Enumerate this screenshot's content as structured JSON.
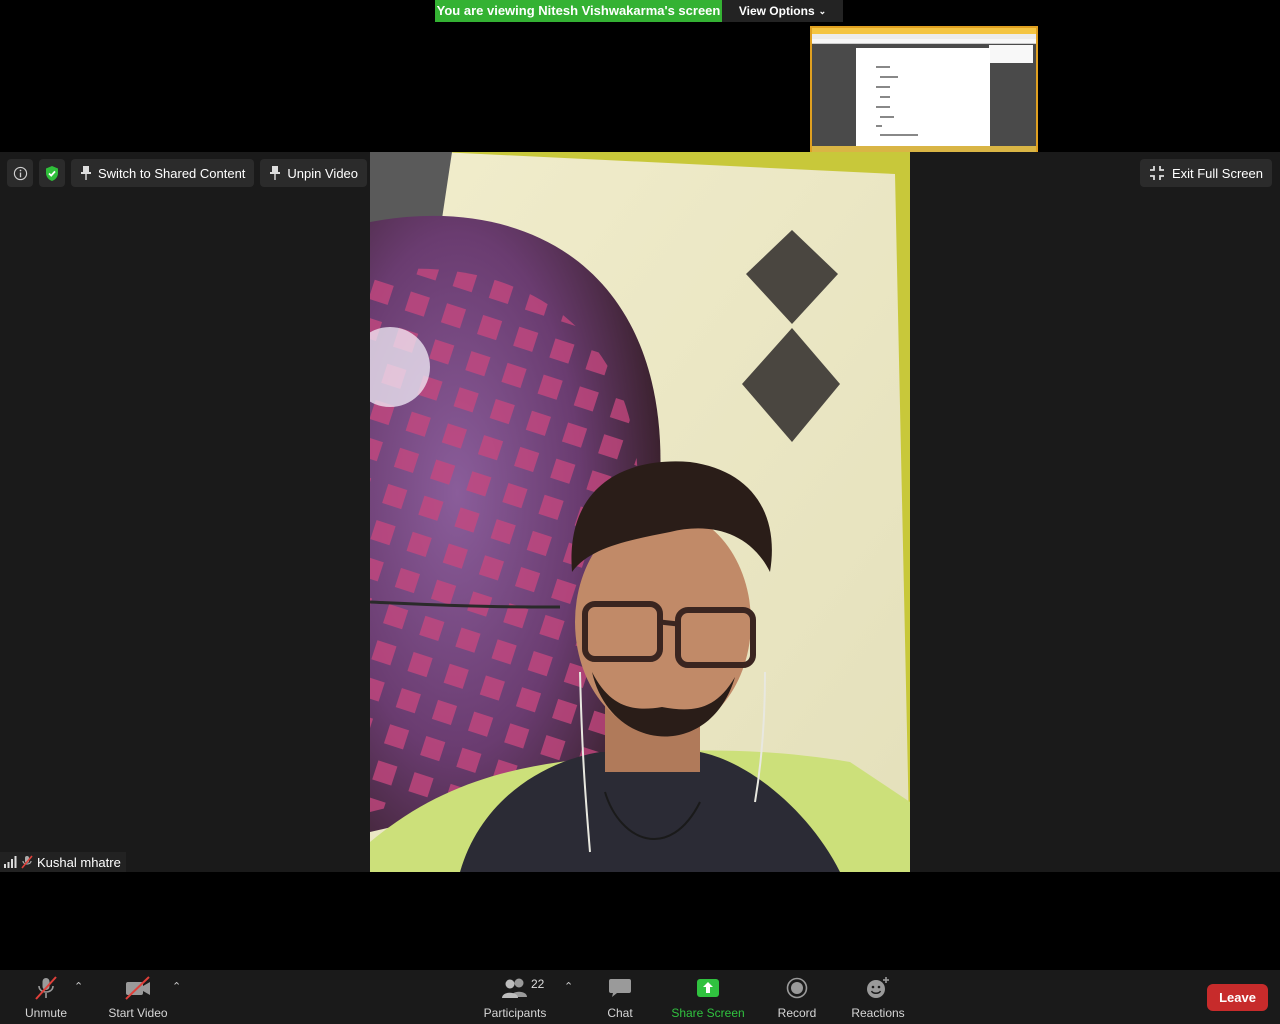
{
  "banner": {
    "status_text": "You are viewing Nitesh Vishwakarma's screen",
    "view_options_label": "View Options",
    "status_color": "#34b233"
  },
  "video_toolbar": {
    "info_icon": "info-icon",
    "encryption_icon": "shield-check-icon",
    "switch_label": "Switch to Shared Content",
    "unpin_label": "Unpin Video",
    "exit_fullscreen_label": "Exit Full Screen"
  },
  "participant": {
    "name": "Kushal mhatre",
    "muted": true
  },
  "controls": {
    "unmute_label": "Unmute",
    "start_video_label": "Start Video",
    "participants_label": "Participants",
    "participants_count": "22",
    "chat_label": "Chat",
    "share_screen_label": "Share Screen",
    "record_label": "Record",
    "reactions_label": "Reactions",
    "leave_label": "Leave",
    "accent_green": "#30c23f",
    "leave_color": "#c72b2b"
  }
}
